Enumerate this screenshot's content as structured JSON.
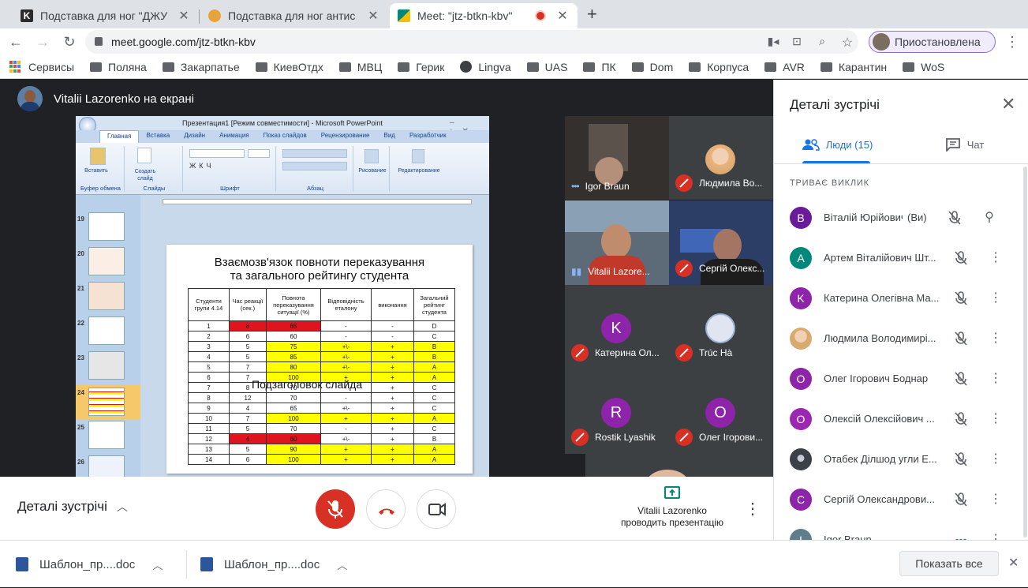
{
  "browser": {
    "tabs": [
      {
        "title": "Подставка для ног \"ДЖУ",
        "active": false,
        "favicon_color": "#2b2b2b"
      },
      {
        "title": "Подставка для ног антис",
        "active": false,
        "favicon_color": "#e8a33d"
      },
      {
        "title": "Meet: \"jtz-btkn-kbv\"",
        "active": true,
        "favicon_color": "#00897b"
      }
    ],
    "new_tab": "+",
    "url": "meet.google.com/jtz-btkn-kbv",
    "profile_label": "Приостановлена",
    "bookmarks": [
      {
        "label": "Сервисы",
        "icon": "apps-grid-icon"
      },
      {
        "label": "Поляна",
        "icon": "folder-icon"
      },
      {
        "label": "Закарпатье",
        "icon": "folder-icon"
      },
      {
        "label": "КиевОтдх",
        "icon": "folder-icon"
      },
      {
        "label": "МВЦ",
        "icon": "folder-icon"
      },
      {
        "label": "Герик",
        "icon": "folder-icon"
      },
      {
        "label": "Lingva",
        "icon": "globe-icon"
      },
      {
        "label": "UAS",
        "icon": "folder-icon"
      },
      {
        "label": "ПК",
        "icon": "folder-icon"
      },
      {
        "label": "Dom",
        "icon": "folder-icon"
      },
      {
        "label": "Корпуса",
        "icon": "folder-icon"
      },
      {
        "label": "AVR",
        "icon": "folder-icon"
      },
      {
        "label": "Карантин",
        "icon": "folder-icon"
      },
      {
        "label": "WoS",
        "icon": "folder-icon"
      }
    ]
  },
  "meet": {
    "presenter_label": "Vitalii Lazorenko на екрані",
    "screen": {
      "window_title": "Презентация1 [Режим совместимости] - Microsoft PowerPoint",
      "ribbon_tabs": [
        "Главная",
        "Вставка",
        "Дизайн",
        "Анимация",
        "Показ слайдов",
        "Рецензирование",
        "Вид",
        "Разработчик"
      ],
      "ribbon_groups": [
        "Буфер обмена",
        "Слайды",
        "Шрифт",
        "Абзац",
        "Рисование",
        "Редактирование"
      ],
      "ribbon_buttons": {
        "paste": "Вставить",
        "new_slide": "Создать слайд",
        "drawing": "Рисование",
        "editing": "Редактирование"
      },
      "thumbnail_numbers": [
        "19",
        "20",
        "21",
        "22",
        "23",
        "24",
        "25",
        "26"
      ],
      "slide_title_line1": "Взаємозв'язок повноти переказування",
      "slide_title_line2": "та загального рейтингу студента",
      "subtitle_placeholder": "Подзаголовок слайда",
      "table_headers": [
        "Студенти групи 4.14",
        "Час реакції (сек.)",
        "Повнота переказування ситуації (%)",
        "Відповідність еталону",
        "виконання",
        "Загальний рейтинг студента"
      ],
      "table_rows": [
        [
          "1",
          "8",
          "65",
          "-",
          "-",
          "D"
        ],
        [
          "2",
          "6",
          "60",
          "-",
          "-",
          "C"
        ],
        [
          "3",
          "5",
          "75",
          "+\\-",
          "+",
          "B"
        ],
        [
          "4",
          "5",
          "85",
          "+\\-",
          "+",
          "B"
        ],
        [
          "5",
          "7",
          "80",
          "+\\-",
          "+",
          "A"
        ],
        [
          "6",
          "7",
          "100",
          "+",
          "+",
          "A"
        ],
        [
          "7",
          "8",
          "70",
          "-",
          "+",
          "C"
        ],
        [
          "8",
          "12",
          "70",
          "-",
          "+",
          "C"
        ],
        [
          "9",
          "4",
          "65",
          "+\\-",
          "+",
          "C"
        ],
        [
          "10",
          "7",
          "100",
          "+",
          "+",
          "A"
        ],
        [
          "11",
          "5",
          "70",
          "-",
          "+",
          "C"
        ],
        [
          "12",
          "4",
          "60",
          "+\\-",
          "+",
          "B"
        ],
        [
          "13",
          "5",
          "90",
          "+",
          "+",
          "A"
        ],
        [
          "14",
          "6",
          "100",
          "+",
          "+",
          "A"
        ]
      ],
      "highlight_colors": {
        "red": "#e0141e",
        "yellow": "#ffff00"
      }
    },
    "tiles": [
      {
        "name": "Igor Braun",
        "muted": false,
        "type": "video"
      },
      {
        "name": "Людмила Во...",
        "muted": true,
        "type": "photo"
      },
      {
        "name": "Vitalii Lazore...",
        "muted": false,
        "type": "video"
      },
      {
        "name": "Сергій Олекс...",
        "muted": true,
        "type": "video"
      },
      {
        "name": "Катерина Ол...",
        "muted": true,
        "type": "letter",
        "letter": "K",
        "color": "#8e24aa"
      },
      {
        "name": "Trúc Hà",
        "muted": true,
        "type": "photo"
      },
      {
        "name": "Rostik Lyashik",
        "muted": true,
        "type": "letter",
        "letter": "R",
        "color": "#8e24aa"
      },
      {
        "name": "Олег Ігорови...",
        "muted": true,
        "type": "letter",
        "letter": "O",
        "color": "#8e24aa"
      }
    ],
    "details_label": "Деталі зустрічі",
    "presenting_line1": "Vitalii Lazorenko",
    "presenting_line2": "проводить презентацію"
  },
  "side_panel": {
    "title": "Деталі зустрічі",
    "tab_people": "Люди (15)",
    "tab_chat": "Чат",
    "section_label": "ТРИВАЄ ВИКЛИК",
    "you_suffix": "(Ви)",
    "people": [
      {
        "name": "Віталій Юрійович ...",
        "initial": "B",
        "color": "#6a1b9a",
        "you": true
      },
      {
        "name": "Артем Віталійович Шт...",
        "initial": "A",
        "color": "#00897b"
      },
      {
        "name": "Катерина Олегівна Ма...",
        "initial": "K",
        "color": "#8e24aa"
      },
      {
        "name": "Людмила Володимирі...",
        "initial": "",
        "color": "#b39c7a"
      },
      {
        "name": "Олег Ігорович Боднар",
        "initial": "O",
        "color": "#8e24aa"
      },
      {
        "name": "Олексій Олексійович ...",
        "initial": "O",
        "color": "#9c27b0"
      },
      {
        "name": "Отабек Ділшод угли Е...",
        "initial": "",
        "color": "#3c4047"
      },
      {
        "name": "Сергій Олександрови...",
        "initial": "C",
        "color": "#8e24aa"
      },
      {
        "name": "Igor Braun",
        "initial": "I",
        "color": "#607d8b"
      }
    ]
  },
  "downloads": {
    "items": [
      "Шаблон_пр....doc",
      "Шаблон_пр....doc"
    ],
    "show_all": "Показать все"
  }
}
